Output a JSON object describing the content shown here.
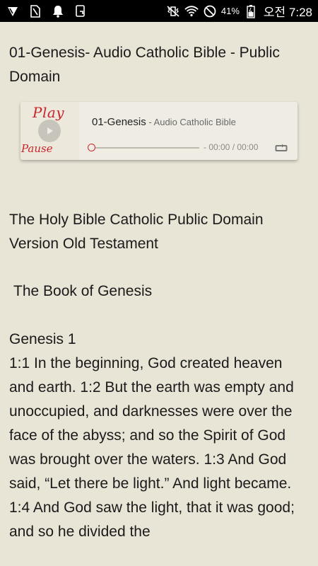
{
  "status_bar": {
    "left_icons": [
      "shield-icon",
      "sim-card-icon",
      "notification-bell-icon",
      "screen-rotate-icon"
    ],
    "right_icons": [
      "vibrate-mute-icon",
      "wifi-icon",
      "do-not-disturb-icon",
      "battery-icon"
    ],
    "battery_percent": "41%",
    "clock": "오전 7:28"
  },
  "page": {
    "title": "01-Genesis- Audio Catholic Bible - Public Domain"
  },
  "player": {
    "art_play_word": "Play",
    "art_pause_word": "Pause",
    "track_title": "01-Genesis",
    "track_artist": " - Audio Catholic Bible",
    "time": "- 00:00 / 00:00",
    "progress": 0,
    "accent_color": "#c8242b"
  },
  "body": {
    "heading_1": "The Holy Bible Catholic Public Domain Version Old Testament",
    "heading_2": "The Book of Genesis",
    "chapter": "Genesis 1",
    "verses": "1:1 In the beginning, God created heaven and earth. 1:2 But the earth was empty and unoccupied, and darknesses were over the face of the abyss; and so the Spirit of God was brought over the waters. 1:3 And God said, “Let there be light.” And light became. 1:4 And God saw the light, that it was good; and so he divided the"
  }
}
